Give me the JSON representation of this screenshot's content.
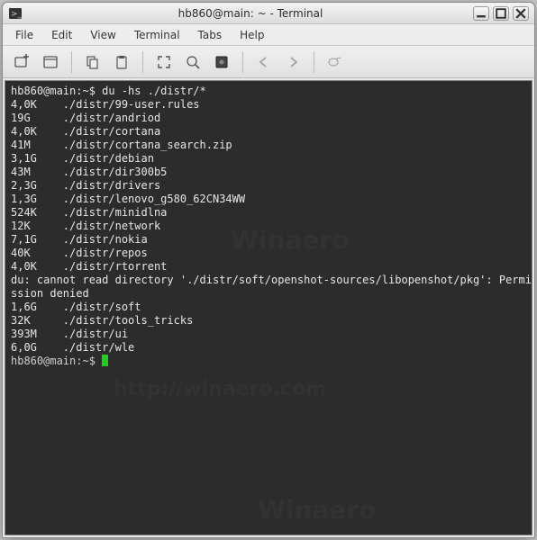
{
  "window": {
    "title": "hb860@main: ~ - Terminal"
  },
  "menubar": {
    "items": [
      "File",
      "Edit",
      "View",
      "Terminal",
      "Tabs",
      "Help"
    ]
  },
  "terminal": {
    "prompt": "hb860@main:~$ ",
    "command": "du -hs ./distr/*",
    "lines": [
      {
        "size": "4,0K",
        "path": "./distr/99-user.rules"
      },
      {
        "size": "19G",
        "path": "./distr/andriod"
      },
      {
        "size": "4,0K",
        "path": "./distr/cortana"
      },
      {
        "size": "41M",
        "path": "./distr/cortana_search.zip"
      },
      {
        "size": "3,1G",
        "path": "./distr/debian"
      },
      {
        "size": "43M",
        "path": "./distr/dir300b5"
      },
      {
        "size": "2,3G",
        "path": "./distr/drivers"
      },
      {
        "size": "1,3G",
        "path": "./distr/lenovo_g580_62CN34WW"
      },
      {
        "size": "524K",
        "path": "./distr/minidlna"
      },
      {
        "size": "12K",
        "path": "./distr/network"
      },
      {
        "size": "7,1G",
        "path": "./distr/nokia"
      },
      {
        "size": "40K",
        "path": "./distr/repos"
      },
      {
        "size": "4,0K",
        "path": "./distr/rtorrent"
      }
    ],
    "error": "du: cannot read directory './distr/soft/openshot-sources/libopenshot/pkg': Permission denied",
    "lines2": [
      {
        "size": "1,6G",
        "path": "./distr/soft"
      },
      {
        "size": "32K",
        "path": "./distr/tools_tricks"
      },
      {
        "size": "393M",
        "path": "./distr/ui"
      },
      {
        "size": "6,0G",
        "path": "./distr/wle"
      }
    ],
    "prompt2": "hb860@main:~$ "
  }
}
